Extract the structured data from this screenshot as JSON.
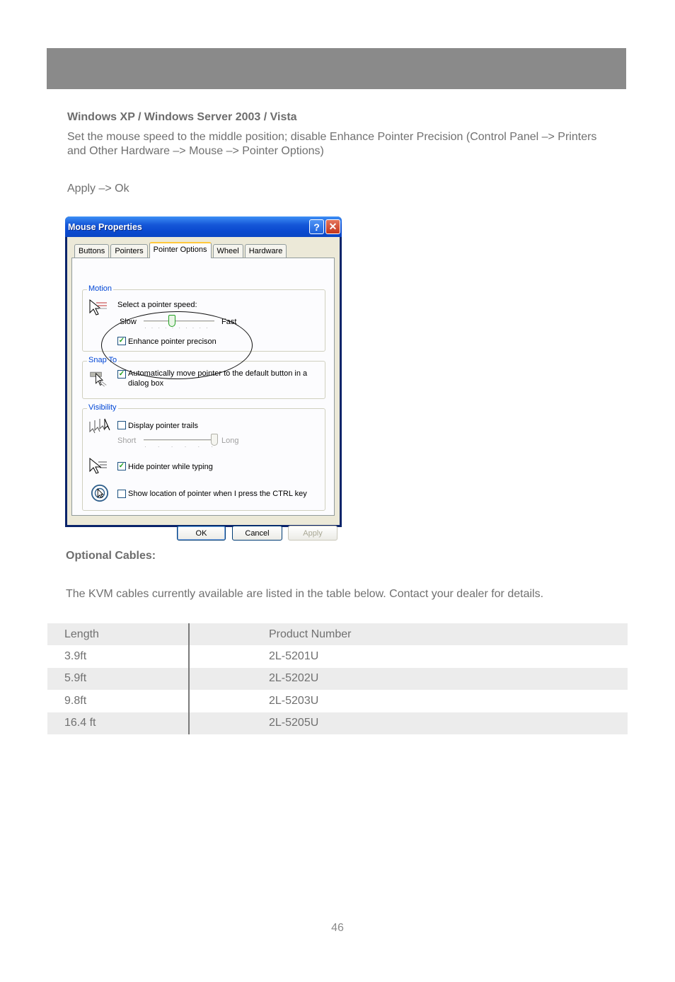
{
  "page": {
    "os_heading": "Windows XP / Windows Server 2003 / Vista",
    "instructions": "Set the mouse speed to the middle position; disable Enhance Pointer Precision (Control Panel –> Printers and Other Hardware –> Mouse –> Pointer Options)",
    "apply_ok": "Apply –> Ok",
    "optional_heading": "Optional Cables:",
    "optional_text": "The KVM cables currently available are listed in the table below.  Contact your dealer for details.",
    "page_number": "46"
  },
  "dialog": {
    "title": "Mouse Properties",
    "help_label": "?",
    "close_label": "✕",
    "tabs": [
      "Buttons",
      "Pointers",
      "Pointer Options",
      "Wheel",
      "Hardware"
    ],
    "active_tab": "Pointer Options",
    "motion": {
      "label": "Motion",
      "speed_prompt": "Select a pointer speed:",
      "slow": "Slow",
      "fast": "Fast",
      "speed_level": 0.4,
      "enhance_label": "Enhance pointer precison",
      "enhance_checked": true
    },
    "snap": {
      "label": "Snap To",
      "option_line1": "Automatically move pointer to the default button in a",
      "option_line2": "dialog box",
      "checked": true
    },
    "visibility": {
      "label": "Visibility",
      "trails_label": "Display pointer trails",
      "trails_checked": false,
      "short": "Short",
      "long": "Long",
      "trail_level": 1.0,
      "hide_label": "Hide pointer while typing",
      "hide_checked": true,
      "ctrl_label": "Show location of pointer when I press the CTRL key",
      "ctrl_checked": false
    },
    "buttons": {
      "ok": "OK",
      "cancel": "Cancel",
      "apply": "Apply"
    },
    "check_glyph": "✓"
  },
  "cable_table": {
    "headers": {
      "length": "Length",
      "product": "Product Number"
    },
    "rows": [
      {
        "length": "3.9ft",
        "product": "2L-5201U"
      },
      {
        "length": "5.9ft",
        "product": "2L-5202U"
      },
      {
        "length": "9.8ft",
        "product": "2L-5203U"
      },
      {
        "length": "16.4 ft",
        "product": "2L-5205U"
      }
    ]
  }
}
